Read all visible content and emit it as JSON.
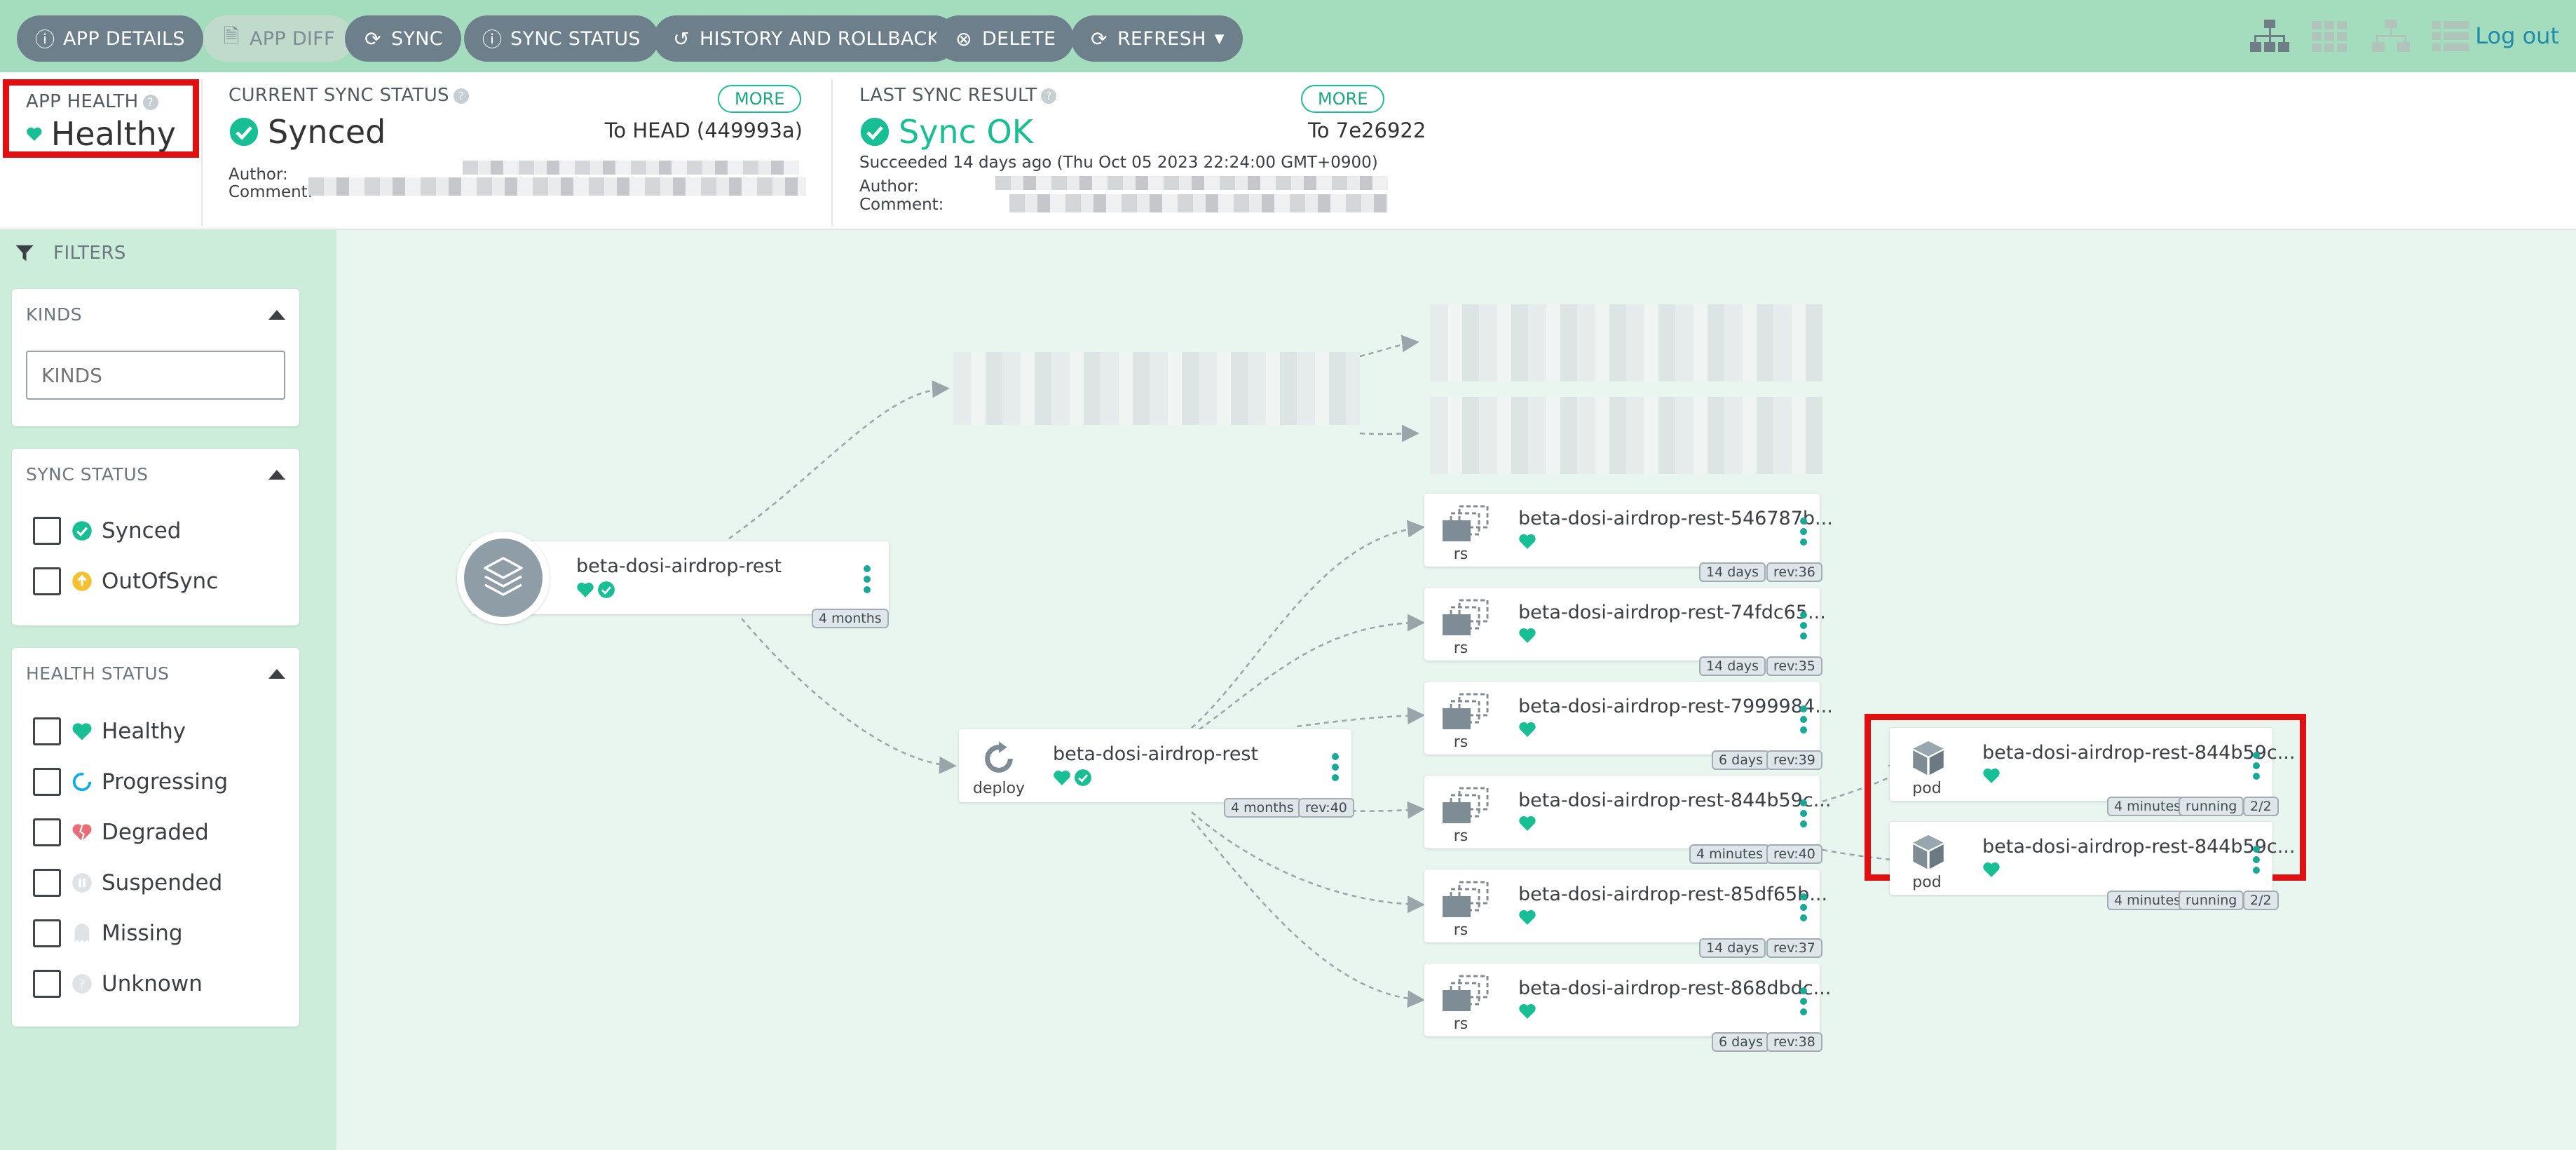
{
  "toolbar": {
    "buttons": {
      "app_details": "APP DETAILS",
      "app_diff": "APP DIFF",
      "sync": "SYNC",
      "sync_status": "SYNC STATUS",
      "history": "HISTORY AND ROLLBACK",
      "delete": "DELETE",
      "refresh": "REFRESH"
    },
    "logout": "Log out"
  },
  "status": {
    "app_health": {
      "title": "APP HEALTH",
      "value": "Healthy"
    },
    "current_sync": {
      "title": "CURRENT SYNC STATUS",
      "value": "Synced",
      "more": "MORE",
      "target": "To HEAD (449993a)",
      "author_label": "Author:",
      "comment_label": "Comment:"
    },
    "last_sync": {
      "title": "LAST SYNC RESULT",
      "value": "Sync OK",
      "more": "MORE",
      "target": "To 7e26922",
      "detail": "Succeeded 14 days ago (Thu Oct 05 2023 22:24:00 GMT+0900)",
      "author_label": "Author:",
      "comment_label": "Comment:"
    }
  },
  "sidebar": {
    "filters_label": "FILTERS",
    "kinds": {
      "title": "KINDS",
      "placeholder": "KINDS"
    },
    "sync_status": {
      "title": "SYNC STATUS",
      "items": [
        "Synced",
        "OutOfSync"
      ]
    },
    "health_status": {
      "title": "HEALTH STATUS",
      "items": [
        "Healthy",
        "Progressing",
        "Degraded",
        "Suspended",
        "Missing",
        "Unknown"
      ]
    }
  },
  "graph": {
    "app": {
      "name": "beta-dosi-airdrop-rest",
      "age": "4 months"
    },
    "deploy": {
      "name": "beta-dosi-airdrop-rest",
      "kind": "deploy",
      "age": "4 months",
      "rev": "rev:40"
    },
    "replicasets": [
      {
        "name": "beta-dosi-airdrop-rest-546787b...",
        "kind": "rs",
        "age": "14 days",
        "rev": "rev:36"
      },
      {
        "name": "beta-dosi-airdrop-rest-74fdc65...",
        "kind": "rs",
        "age": "14 days",
        "rev": "rev:35"
      },
      {
        "name": "beta-dosi-airdrop-rest-7999984...",
        "kind": "rs",
        "age": "6 days",
        "rev": "rev:39"
      },
      {
        "name": "beta-dosi-airdrop-rest-844b59c...",
        "kind": "rs",
        "age": "4 minutes",
        "rev": "rev:40"
      },
      {
        "name": "beta-dosi-airdrop-rest-85df65b...",
        "kind": "rs",
        "age": "14 days",
        "rev": "rev:37"
      },
      {
        "name": "beta-dosi-airdrop-rest-868dbdc...",
        "kind": "rs",
        "age": "6 days",
        "rev": "rev:38"
      }
    ],
    "pods": [
      {
        "name": "beta-dosi-airdrop-rest-844b59c...",
        "kind": "pod",
        "age": "4 minutes",
        "state": "running",
        "ready": "2/2"
      },
      {
        "name": "beta-dosi-airdrop-rest-844b59c...",
        "kind": "pod",
        "age": "4 minutes",
        "state": "running",
        "ready": "2/2"
      }
    ]
  },
  "colors": {
    "healthy": "#18be94",
    "toolbar": "#a3ddbe",
    "button": "#6d7f8b",
    "highlight": "#e01010",
    "link": "#1e8ba8"
  },
  "icons": [
    "info-icon",
    "file-icon",
    "sync-icon",
    "history-icon",
    "delete-icon",
    "refresh-icon",
    "tree-view-icon",
    "pods-view-icon",
    "network-view-icon",
    "list-view-icon",
    "heart-icon",
    "check-circle-icon",
    "filter-icon",
    "app-layers-icon",
    "deploy-icon",
    "replicaset-icon",
    "pod-cube-icon",
    "kebab-menu-icon"
  ]
}
